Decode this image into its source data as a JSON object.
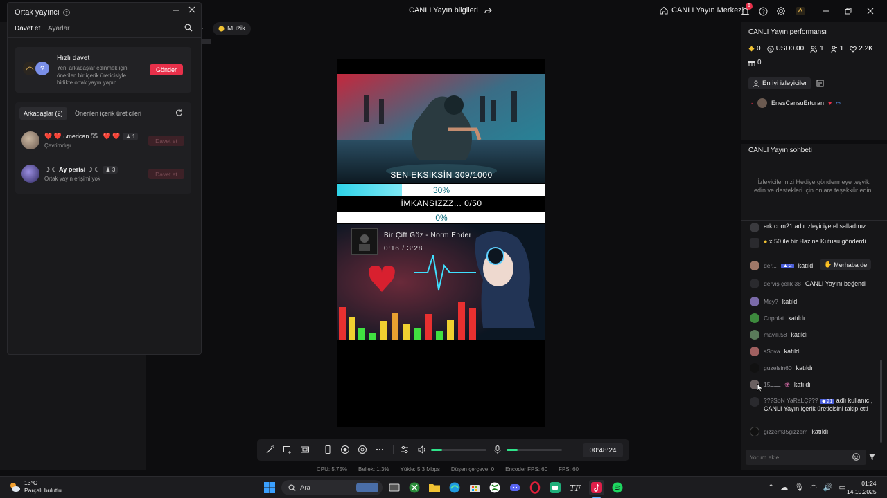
{
  "topbar": {
    "title": "CANLI Yayın bilgileri",
    "live_center": "CANLI Yayın Merkezi",
    "notif_count": "6"
  },
  "background": {
    "chip_a": "a",
    "chip_muzik": "Müzik"
  },
  "cohost": {
    "title": "Ortak yayıncı",
    "tabs": [
      "Davet et",
      "Ayarlar"
    ],
    "quick": {
      "title": "Hızlı davet",
      "desc": "Yeni arkadaşlar edinmek için önerilen bir içerik üreticisiyle birlikte ortak yayın yapın",
      "send": "Gönder"
    },
    "friends_tab": "Arkadaşlar (2)",
    "suggested_tab": "Önerilen içerik üreticileri",
    "friends": [
      {
        "name": "❤️ ❤️ ᴗmerican 55.. ❤️ ❤️",
        "count": "1",
        "status": "Çevrimdışı",
        "invite": "Davet et"
      },
      {
        "name": "☽ ☾ 𝐀𝐲 𝐩𝐞𝐫𝐢𝐬𝐢 ☽ ☾",
        "count": "3",
        "status": "Ortak yayın erişimi yok",
        "invite": "Davet et"
      }
    ]
  },
  "preview": {
    "goal1_label": "SEN EKSİKSİN 309/1000",
    "goal1_pct": "30%",
    "goal1_value": 0.309,
    "goal2_label": "İMKANSIZZZ... 0/50",
    "goal2_pct": "0%",
    "goal2_value": 0,
    "song_title": "Bir Çift Göz - Norm Ender",
    "song_time": "0:16 / 3:28"
  },
  "controls": {
    "timer": "00:48:24",
    "volume": 0.2,
    "mic": 0.2
  },
  "stats": {
    "cpu": "CPU:  5.75%",
    "mem": "Bellek:  1.3%",
    "upload": "Yükle:  5.3 Mbps",
    "dropped": "Düşen çerçeve:  0",
    "encoder": "Encoder FPS:  60",
    "fps": "FPS:  60"
  },
  "performance": {
    "title": "CANLI Yayın performansı",
    "coins": "0",
    "usd": "USD0.00",
    "viewers": "1",
    "followers": "1",
    "likes": "2.2K",
    "gifts": "0",
    "top_viewers_btn": "En iyi izleyiciler",
    "top_viewer_rank": "-",
    "top_viewer_name": "EnesCansuErturan"
  },
  "chat": {
    "title": "CANLI Yayın sohbeti",
    "hint": "İzleyicilerinizi Hediye göndermeye teşvik edin ve destekleri için onlara teşekkür edin.",
    "messages": [
      {
        "user": "",
        "text": "ark.com21 adlı izleyiciye el salladınız"
      },
      {
        "user": "",
        "text": "x 50 ile bir Hazine Kutusu gönderdi"
      },
      {
        "user": "der...",
        "text": "katıldı",
        "badge": "2"
      },
      {
        "user": "derviş çelik 38",
        "text": "CANLI Yayını beğendi"
      },
      {
        "user": "Mey?",
        "text": "katıldı"
      },
      {
        "user": "Cnpolat",
        "text": "katıldı"
      },
      {
        "user": "mavili.58",
        "text": "katıldı"
      },
      {
        "user": "sSova",
        "text": "katıldı"
      },
      {
        "user": "guzelsin60",
        "text": "katıldı"
      },
      {
        "user": "1ـــ.ــ5",
        "text": "katıldı"
      },
      {
        "user": "???SoN YaRaLÇ???",
        "text": "adlı kullanıcı, CANLI Yayın içerik üreticisini takip etti",
        "badge": "21"
      },
      {
        "user": "gizzem35gizzem",
        "text": "katıldı"
      }
    ],
    "wave_btn": "Merhaba de",
    "comment_placeholder": "Yorum ekle"
  },
  "taskbar": {
    "temp": "13°C",
    "weather": "Parçalı bulutlu",
    "search": "Ara",
    "time": "01:24",
    "date": "14.10.2025"
  },
  "colors": {
    "accent": "#e8304a",
    "goal_fill": "#2fd3e8",
    "slider": "#2fe38a"
  }
}
